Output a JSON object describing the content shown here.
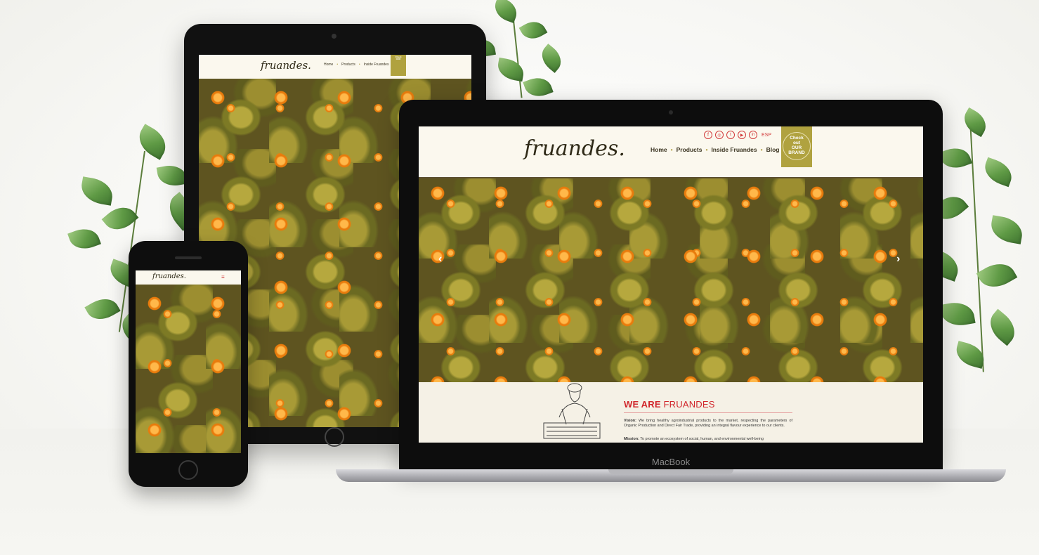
{
  "site": {
    "logo": "fruandes.",
    "nav": [
      "Home",
      "Products",
      "Inside Fruandes",
      "Blog"
    ],
    "lang": "ESP",
    "badge": [
      "Check",
      "out",
      "OUR",
      "BRAND"
    ],
    "social_icons": [
      "facebook-icon",
      "instagram-icon",
      "twitter-icon",
      "youtube-icon",
      "linkedin-icon"
    ],
    "about": {
      "title_bold": "WE ARE",
      "title_rest": "FRUANDES",
      "vision_label": "Vision:",
      "vision_text": "We bring healthy agroindustrial products to the market, respecting the parameters of Organic Production and Direct Fair Trade, providing an integral flavour experience to our clients.",
      "mission_label": "Mission:",
      "mission_text": "To promote an ecosystem of social, human, and environmental well-being"
    }
  },
  "laptop": {
    "brand": "MacBook"
  },
  "colors": {
    "accent_red": "#d23c3c",
    "badge_olive": "#b0a23f",
    "page_bg": "#fbf8ee"
  }
}
